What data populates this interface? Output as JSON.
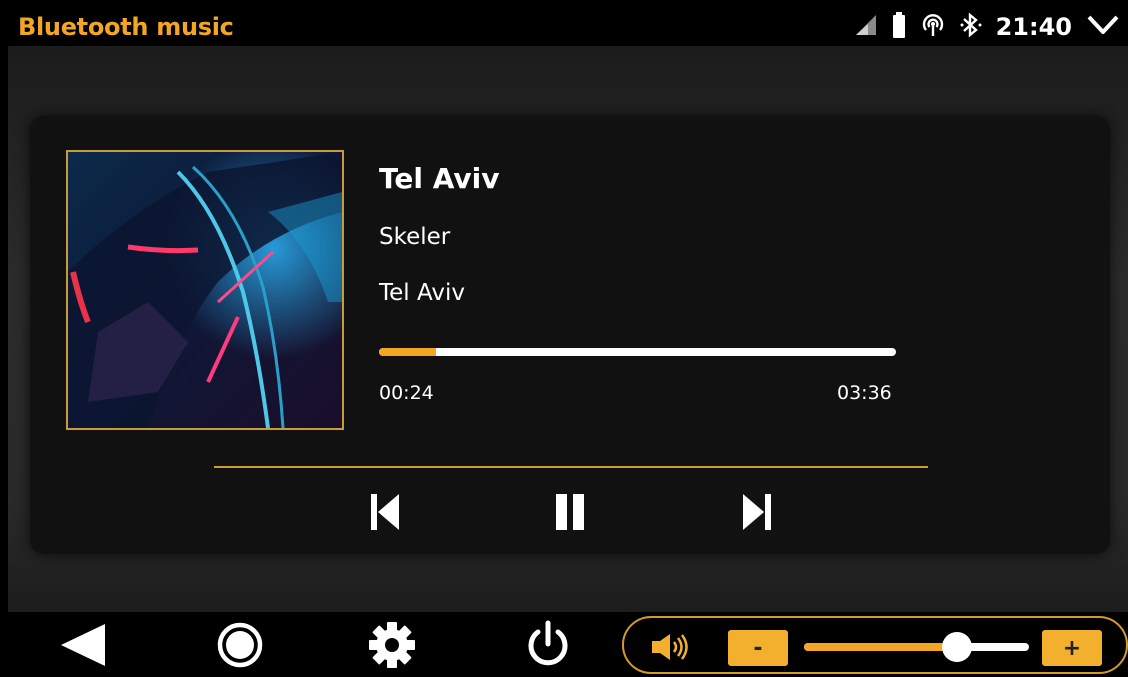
{
  "status_bar": {
    "app_title": "Bluetooth music",
    "time": "21:40",
    "icons": [
      "signal-icon",
      "battery-icon",
      "hotspot-icon",
      "bluetooth-icon",
      "chevron-down-icon"
    ]
  },
  "player": {
    "title": "Tel Aviv",
    "artist": "Skeler",
    "album": "Tel Aviv",
    "elapsed": "00:24",
    "duration": "03:36",
    "progress_fraction": 0.11,
    "controls": [
      "previous-icon",
      "pause-icon",
      "next-icon"
    ]
  },
  "nav": {
    "buttons": [
      "back-icon",
      "home-icon",
      "settings-icon",
      "power-icon"
    ]
  },
  "volume": {
    "icon": "speaker-icon",
    "minus_label": "-",
    "plus_label": "+",
    "level_fraction": 0.68
  },
  "colors": {
    "accent": "#f2a623",
    "border_accent": "#d39a2c"
  }
}
